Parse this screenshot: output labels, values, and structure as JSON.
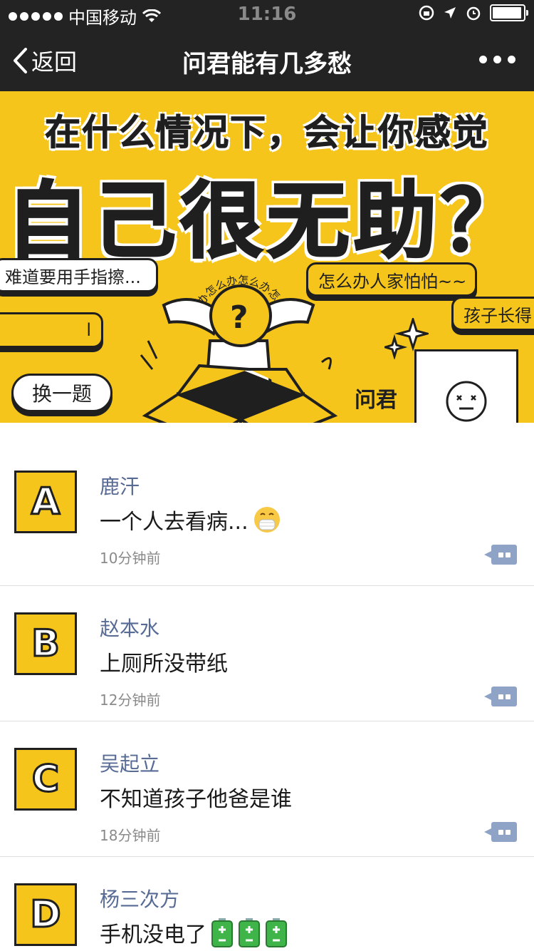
{
  "status_bar": {
    "carrier": "中国移动",
    "time": "11:16"
  },
  "nav": {
    "back_label": "返回",
    "title": "问君能有几多愁"
  },
  "banner": {
    "headline_line1": "在什么情况下，会让你感觉",
    "headline_line2": "自己很无助？",
    "bubbles": [
      "难道要用手指擦...",
      "怎么办人家怕怕~~",
      "孩子长得",
      "l"
    ],
    "circle_text": "怎么办怎么办怎么办怎么办",
    "change_button": "换一题",
    "author_label": "问君",
    "colors": {
      "banner_bg": "#f6c51c",
      "ink": "#1f1f1f"
    }
  },
  "feed": [
    {
      "letter": "A",
      "name": "鹿汗",
      "content": "一个人去看病...",
      "emoji": [
        "mask-face-emoji"
      ],
      "time": "10分钟前"
    },
    {
      "letter": "B",
      "name": "赵本水",
      "content": "上厕所没带纸",
      "emoji": [],
      "time": "12分钟前"
    },
    {
      "letter": "C",
      "name": "吴起立",
      "content": "不知道孩子他爸是谁",
      "emoji": [],
      "time": "18分钟前"
    },
    {
      "letter": "D",
      "name": "杨三次方",
      "content": "手机没电了",
      "emoji": [
        "battery-emoji",
        "battery-emoji",
        "battery-emoji"
      ],
      "time": ""
    }
  ],
  "colors": {
    "name_link": "#576b95",
    "comment_icon": "#8fa3c6",
    "nav_bg": "#232323"
  }
}
